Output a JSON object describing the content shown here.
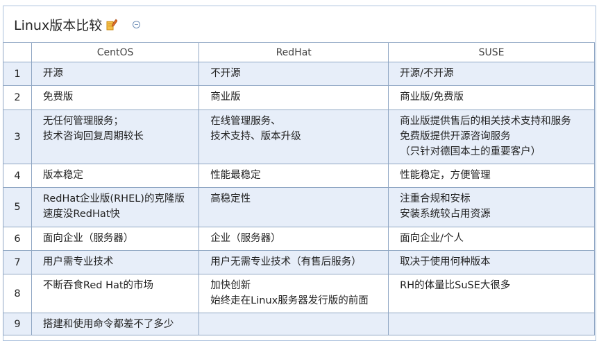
{
  "page": {
    "title": "Linux版本比较",
    "edit_icon": "edit-pencil-icon",
    "collapse_icon": "collapse-circle-icon"
  },
  "table": {
    "headers": [
      "",
      "CentOS",
      "RedHat",
      "SUSE"
    ],
    "rows": [
      {
        "num": "1",
        "centos": [
          "开源"
        ],
        "redhat": [
          "不开源"
        ],
        "suse": [
          "开源/不开源"
        ]
      },
      {
        "num": "2",
        "centos": [
          "免费版"
        ],
        "redhat": [
          "商业版"
        ],
        "suse": [
          "商业版/免费版"
        ]
      },
      {
        "num": "3",
        "centos": [
          "无任何管理服务；",
          "技术咨询回复周期较长"
        ],
        "redhat": [
          "在线管理服务、",
          "技术支持、版本升级"
        ],
        "suse": [
          "商业版提供售后的相关技术支持和服务",
          "免费版提供开源咨询服务",
          "（只针对德国本土的重要客户）"
        ]
      },
      {
        "num": "4",
        "centos": [
          "版本稳定"
        ],
        "redhat": [
          "性能最稳定"
        ],
        "suse": [
          "性能稳定，方便管理"
        ]
      },
      {
        "num": "5",
        "centos": [
          "RedHat企业版(RHEL)的克隆版",
          "速度没RedHat快"
        ],
        "redhat": [
          "高稳定性"
        ],
        "suse": [
          "注重合规和安标",
          "安装系统较占用资源"
        ]
      },
      {
        "num": "6",
        "centos": [
          "面向企业（服务器）"
        ],
        "redhat": [
          "企业（服务器）"
        ],
        "suse": [
          "面向企业/个人"
        ]
      },
      {
        "num": "7",
        "centos": [
          "用户需专业技术"
        ],
        "redhat": [
          "用户无需专业技术（有售后服务）"
        ],
        "suse": [
          "取决于使用何种版本"
        ]
      },
      {
        "num": "8",
        "centos": [
          "不断吞食Red Hat的市场"
        ],
        "redhat": [
          "加快创新",
          "始终走在Linux服务器发行版的前面"
        ],
        "suse": [
          "RH的体量比SuSE大很多"
        ]
      },
      {
        "num": "9",
        "centos": [
          "搭建和使用命令都差不了多少"
        ],
        "redhat": [],
        "suse": []
      }
    ]
  },
  "colors": {
    "border": "#8fa6c3",
    "odd_row": "#e7eef9",
    "even_row": "#ffffff"
  }
}
